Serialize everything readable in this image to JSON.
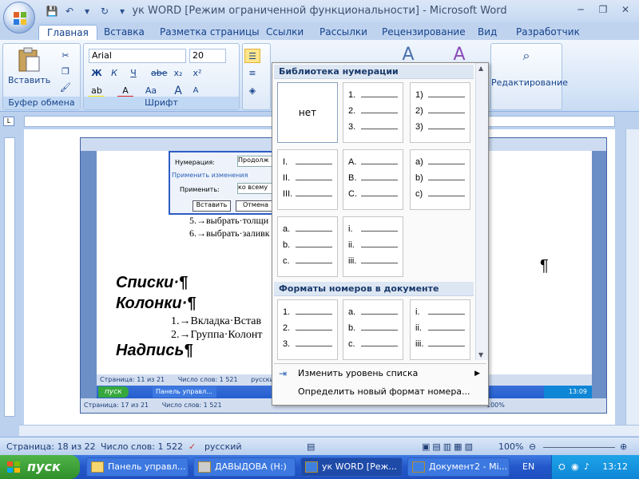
{
  "window": {
    "title": "ук WORD [Режим ограниченной функциональности] - Microsoft Word"
  },
  "tabs": [
    {
      "label": "Главная"
    },
    {
      "label": "Вставка"
    },
    {
      "label": "Разметка страницы"
    },
    {
      "label": "Ссылки"
    },
    {
      "label": "Рассылки"
    },
    {
      "label": "Рецензирование"
    },
    {
      "label": "Вид"
    },
    {
      "label": "Разработчик"
    }
  ],
  "ribbon": {
    "clipboard": {
      "label": "Буфер обмена",
      "paste_label": "Вставить"
    },
    "font": {
      "label": "Шрифт",
      "font_name": "Arial",
      "font_size": "20",
      "bold": "Ж",
      "italic": "К",
      "underline": "Ч",
      "strike": "abe",
      "subscript": "x₂",
      "superscript": "x²",
      "case": "Aa"
    },
    "editing": {
      "label": "Редактирование"
    }
  },
  "numbering_menu": {
    "library_header": "Библиотека нумерации",
    "doc_formats_header": "Форматы номеров в документе",
    "none_label": "нет",
    "library": [
      [
        "1.",
        "2.",
        "3."
      ],
      [
        "1)",
        "2)",
        "3)"
      ],
      [
        "I.",
        "II.",
        "III."
      ],
      [
        "A.",
        "B.",
        "C."
      ],
      [
        "a)",
        "b)",
        "c)"
      ],
      [
        "a.",
        "b.",
        "c."
      ],
      [
        "i.",
        "ii.",
        "iii."
      ]
    ],
    "doc_formats": [
      [
        "1.",
        "2.",
        "3."
      ],
      [
        "a.",
        "b.",
        "c."
      ],
      [
        "i.",
        "ii.",
        "iii."
      ]
    ],
    "change_level": "Изменить уровень списка",
    "define_new": "Определить новый формат номера..."
  },
  "document": {
    "heading1": "Списки·¶",
    "heading2": "Колонки·¶",
    "line1": "1.→Вкладка·Встав",
    "line2": "2.→Группа·Колонт",
    "heading3": "Надпись¶",
    "pilcrow": "¶",
    "inner": {
      "dialog_numbering_label": "Нумерация:",
      "dialog_numbering_value": "Продолж",
      "dialog_apply_changes": "Применить изменения",
      "dialog_apply_label": "Применить:",
      "dialog_apply_value": "ко всему",
      "dialog_insert_button": "Вставить",
      "dialog_cancel_button": "Отмена",
      "list_item5": "5.→выбрать·толщи",
      "list_item6": "6.→выбрать·заливк",
      "status_page": "Страница: 11 из 21",
      "status_words": "Число слов: 1 521",
      "status_lang": "русский",
      "task_start": "пуск",
      "task_panel": "Панель управл...",
      "task_time": "13:09",
      "status2_page": "Страница: 17 из 21",
      "status2_words": "Число слов: 1 521",
      "zoom": "100%"
    }
  },
  "statusbar": {
    "page": "Страница: 18 из 22",
    "words": "Число слов: 1 522",
    "language": "русский",
    "zoom": "100%"
  },
  "taskbar": {
    "start": "пуск",
    "items": [
      {
        "label": "Панель управл..."
      },
      {
        "label": "ДАВЫДОВА (H:)"
      },
      {
        "label": "ук WORD [Реж..."
      },
      {
        "label": "Документ2 - Mi..."
      }
    ],
    "lang": "EN",
    "time": "13:12"
  }
}
